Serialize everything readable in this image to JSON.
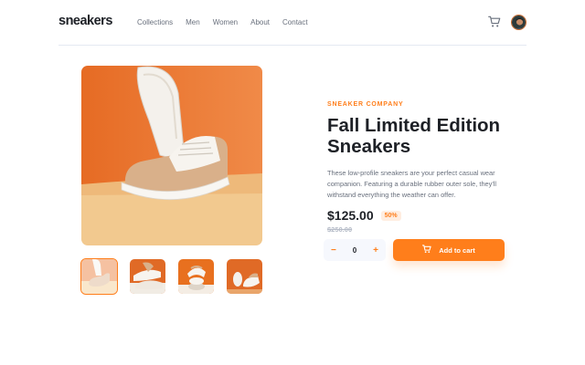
{
  "header": {
    "logo": "sneakers",
    "nav": [
      "Collections",
      "Men",
      "Women",
      "About",
      "Contact"
    ],
    "cart_icon": "cart-icon",
    "avatar_icon": "user-avatar"
  },
  "product": {
    "company": "SNEAKER COMPANY",
    "title": "Fall Limited Edition Sneakers",
    "description": "These low-profile sneakers are your perfect casual wear companion. Featuring a durable rubber outer sole, they'll withstand everything the weather can offer.",
    "price": "$125.00",
    "discount": "50%",
    "old_price": "$250.00"
  },
  "gallery": {
    "thumbnails_count": 4,
    "active_thumbnail": 1
  },
  "cart": {
    "minus": "−",
    "quantity": "0",
    "plus": "+",
    "add_label": "Add to cart"
  },
  "colors": {
    "accent": "#ff7e1b",
    "dark": "#1d2026",
    "text_muted": "#69707d"
  }
}
